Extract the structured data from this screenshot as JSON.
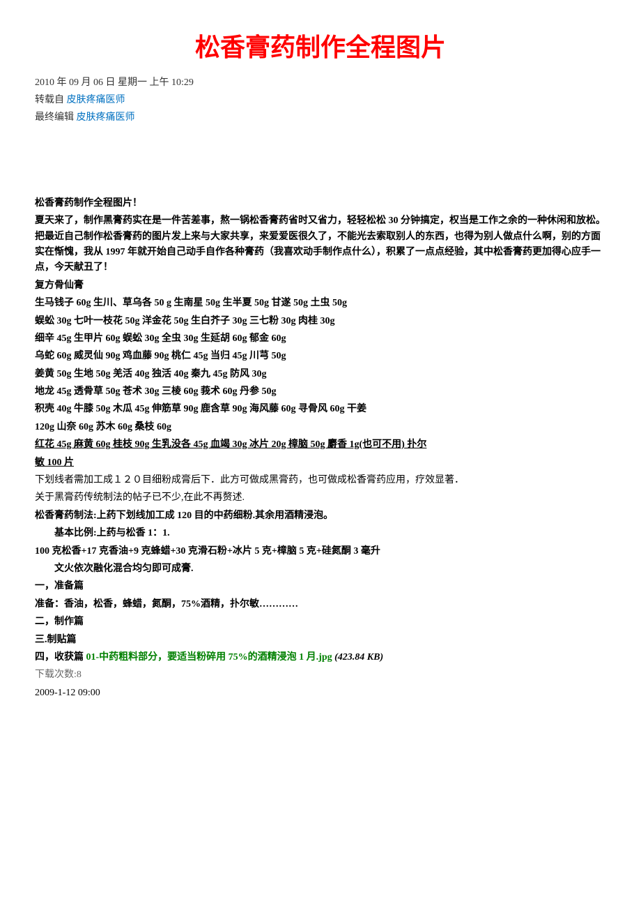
{
  "title": "松香膏药制作全程图片",
  "date_line": "2010 年 09 月 06 日 星期一 上午 10:29",
  "repost_label": "转载自 ",
  "repost_author": "皮肤疼痛医师",
  "editor_label": "最终编辑 ",
  "editor_name": "皮肤疼痛医师",
  "intro_title": "松香膏药制作全程图片！",
  "intro_p1": "夏天来了，制作黑膏药实在是一件苦差事，熬一锅松香膏药省时又省力，轻轻松松 30 分钟搞定，权当是工作之余的一种休闲和放松。把最近自己制作松香膏药的图片发上来与大家共享，来爱爱医很久了，不能光去索取别人的东西，也得为别人做点什么啊，别的方面实在惭愧，我从 1997 年就开始自己动手自作各种膏药（我喜欢动手制作点什么），积累了一点点经验，其中松香膏药更加得心应手一点，今天献丑了！",
  "formula_name": "复方骨仙膏",
  "herb_lines": [
    "生马钱子 60g      生川、草乌各 50 g          生南星 50g      生半夏 50g      甘遂 50g        土虫 50g",
    "蜈蚣 30g           七叶一枝花 50g           洋金花 50g      生白芥子 30g      三七粉 30g    肉桂 30g",
    "细辛 45g           生甲片 60g                    蜈蚣 30g        全虫 30g         生延胡 60g       郁金 60g",
    "乌蛇 60g           威灵仙 90g                    鸡血藤 90g       桃仁 45g          当归 45g        川芎 50g",
    "姜黄 50g          生地 50g                       羌活 40g        独活 40g        秦九 45g        防风 30g",
    "地龙 45g         透骨草 50g                     苍术 30g        三棱 60g          莪术 60g       丹参 50g",
    "积壳 40g          牛膝 50g                     木瓜 45g         伸筋草 90g     鹿含草 90g    海风藤 60g        寻骨风 60g           干姜",
    "120g               山奈 60g          苏木 60g           桑枝 60g"
  ],
  "underline_line_1": "红花 45g      麻黄 60g                   桂枝 90g      生乳没各 45g       血竭 30g      冰片 20g        樟脑 50g       麝香 1g(也可不用)          扑尔",
  "underline_line_2": "敏 100 片",
  "instruction_p1": "下划线者需加工成１２０目细粉成膏后下．此方可做成黑膏药，也可做成松香膏药应用，疗效显著．",
  "instruction_p2": "关于黑膏药传统制法的帖子已不少,在此不再赘述.",
  "instruction_p3": "松香膏药制法:上药下划线加工成 120 目的中药细粉.其余用酒精浸泡。",
  "instruction_p4": "基本比例:上药与松香 1：1.",
  "instruction_p5": "100 克松香+17 克香油+9 克蜂蜡+30 克滑石粉+冰片 5 克+樟脑 5 克+硅氮酮 3 毫升",
  "instruction_p6": "文火依次融化混合均匀即可成膏.",
  "section_1": "一，准备篇",
  "section_1_content": "准备：香油，松香，蜂蜡，氮酮，75%酒精，扑尔敏…………",
  "section_2": "二，制作篇",
  "section_3": "三.制贴篇",
  "section_4_prefix": "四，收获篇 ",
  "section_4_link": "01-中药粗料部分，要适当粉碎用 75%的酒精浸泡 1 月.jpg",
  "section_4_size": " (423.84 KB)",
  "download_count": "下载次数:8",
  "timestamp": "2009-1-12 09:00"
}
